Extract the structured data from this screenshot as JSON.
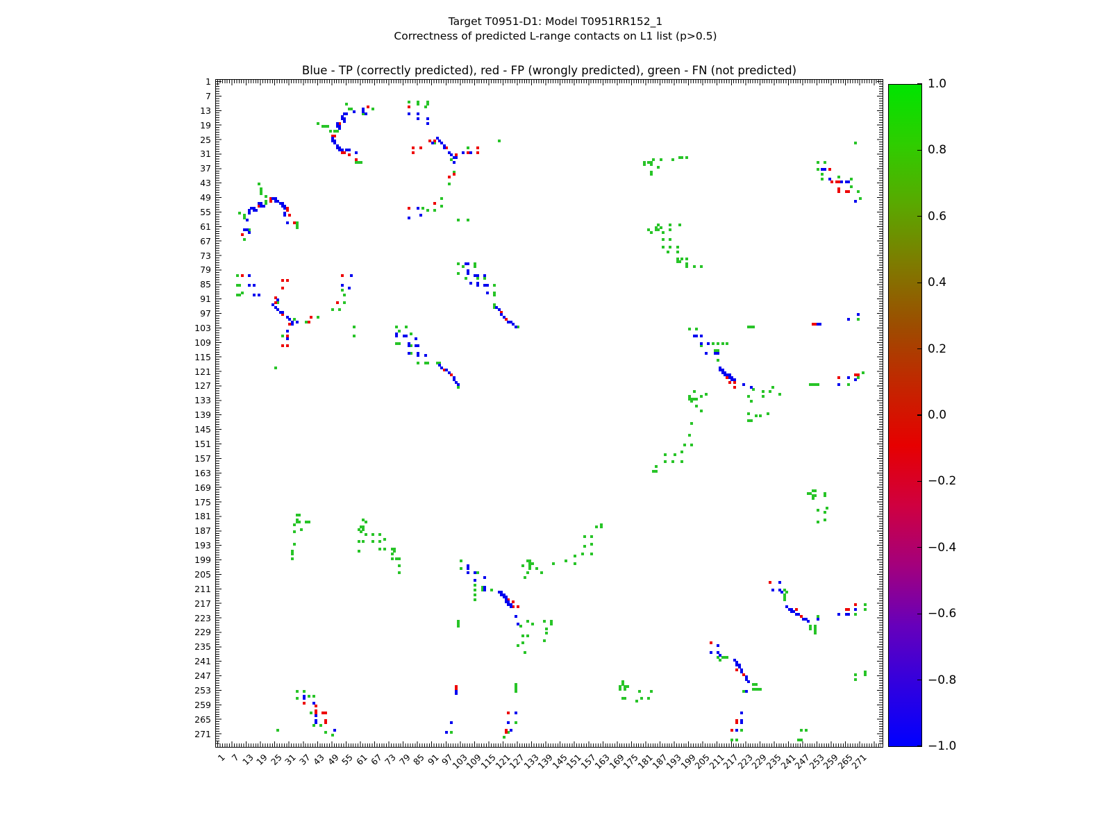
{
  "header": {
    "title_line1": "Target T0951-D1: Model T0951RR152_1",
    "title_line2": "Correctness of predicted L-range contacts on L1 list (p>0.5)"
  },
  "chart_data": {
    "type": "scatter",
    "title": "Blue - TP (correctly predicted), red - FP (wrongly predicted), green - FN (not predicted)",
    "xlabel": "",
    "ylabel": "",
    "axis": {
      "tick_first": 1,
      "tick_step": 6,
      "tick_last": 271,
      "xlim": [
        1,
        277
      ],
      "ylim": [
        277,
        1
      ],
      "y_inverted": true,
      "grid": false,
      "minor_ticks_every": 1
    },
    "legend": {
      "TP": {
        "label": "TP (correctly predicted)",
        "color": "#0000f0"
      },
      "FP": {
        "label": "FP (wrongly predicted)",
        "color": "#ee0000"
      },
      "FN": {
        "label": "FN (not predicted)",
        "color": "#28c428"
      }
    },
    "symmetric": true,
    "points_encoding": "pairs [residue_i, residue_j] on a symmetric contact map; each pair is also plotted mirrored [j,i]",
    "points": {
      "TP": [
        [
          49,
          24
        ],
        [
          49,
          25
        ],
        [
          50,
          25
        ],
        [
          50,
          26
        ],
        [
          51,
          27
        ],
        [
          51,
          28
        ],
        [
          52,
          28
        ],
        [
          52,
          29
        ],
        [
          53,
          29
        ],
        [
          51,
          18
        ],
        [
          51,
          19
        ],
        [
          52,
          19
        ],
        [
          52,
          20
        ],
        [
          53,
          15
        ],
        [
          53,
          16
        ],
        [
          54,
          16
        ],
        [
          54,
          17
        ],
        [
          54,
          14
        ],
        [
          55,
          14
        ],
        [
          55,
          29
        ],
        [
          56,
          29
        ],
        [
          58,
          13
        ],
        [
          59,
          30
        ],
        [
          62,
          12
        ],
        [
          62,
          13
        ],
        [
          63,
          14
        ],
        [
          81,
          14
        ],
        [
          85,
          14
        ],
        [
          85,
          16
        ],
        [
          89,
          16
        ],
        [
          89,
          18
        ],
        [
          91,
          26
        ],
        [
          81,
          57
        ],
        [
          85,
          53
        ],
        [
          86,
          56
        ],
        [
          93,
          24
        ],
        [
          94,
          25
        ],
        [
          95,
          26
        ],
        [
          96,
          27
        ],
        [
          96,
          28
        ],
        [
          98,
          30
        ],
        [
          99,
          31
        ],
        [
          100,
          32
        ],
        [
          101,
          32
        ],
        [
          100,
          34
        ],
        [
          104,
          30
        ],
        [
          107,
          30
        ],
        [
          105,
          76
        ],
        [
          106,
          76
        ],
        [
          106,
          79
        ],
        [
          106,
          80
        ],
        [
          107,
          84
        ],
        [
          109,
          81
        ],
        [
          110,
          81
        ],
        [
          110,
          84
        ],
        [
          110,
          85
        ],
        [
          113,
          81
        ],
        [
          113,
          85
        ],
        [
          114,
          85
        ],
        [
          114,
          88
        ],
        [
          118,
          94
        ],
        [
          119,
          95
        ],
        [
          120,
          97
        ],
        [
          121,
          98
        ],
        [
          123,
          100
        ],
        [
          124,
          100
        ],
        [
          125,
          101
        ],
        [
          126,
          102
        ],
        [
          201,
          106
        ],
        [
          202,
          106
        ],
        [
          204,
          106
        ],
        [
          204,
          109
        ],
        [
          206,
          113
        ],
        [
          207,
          109
        ],
        [
          210,
          113
        ],
        [
          211,
          113
        ],
        [
          212,
          119
        ],
        [
          212,
          120
        ],
        [
          213,
          120
        ],
        [
          213,
          121
        ],
        [
          214,
          121
        ],
        [
          214,
          122
        ],
        [
          215,
          122
        ],
        [
          216,
          122
        ],
        [
          216,
          123
        ],
        [
          217,
          123
        ],
        [
          217,
          124
        ],
        [
          218,
          124
        ],
        [
          222,
          126
        ],
        [
          225,
          127
        ],
        [
          253,
          101
        ],
        [
          254,
          101
        ],
        [
          262,
          126
        ],
        [
          266,
          123
        ],
        [
          269,
          124
        ],
        [
          266,
          99
        ],
        [
          270,
          97
        ],
        [
          255,
          37
        ],
        [
          256,
          37
        ],
        [
          258,
          41
        ],
        [
          263,
          42
        ],
        [
          265,
          42
        ],
        [
          266,
          42
        ],
        [
          269,
          50
        ],
        [
          234,
          211
        ],
        [
          237,
          208
        ],
        [
          237,
          211
        ],
        [
          238,
          212
        ],
        [
          240,
          218
        ],
        [
          241,
          219
        ],
        [
          242,
          219
        ],
        [
          242,
          220
        ],
        [
          243,
          220
        ],
        [
          244,
          221
        ],
        [
          245,
          221
        ],
        [
          247,
          223
        ],
        [
          248,
          223
        ],
        [
          249,
          224
        ],
        [
          253,
          223
        ],
        [
          262,
          221
        ],
        [
          265,
          221
        ],
        [
          266,
          221
        ],
        [
          269,
          219
        ]
      ],
      "FP": [
        [
          49,
          23
        ],
        [
          50,
          23
        ],
        [
          52,
          18
        ],
        [
          53,
          30
        ],
        [
          54,
          30
        ],
        [
          56,
          31
        ],
        [
          59,
          33
        ],
        [
          64,
          11
        ],
        [
          81,
          11
        ],
        [
          90,
          25
        ],
        [
          83,
          28
        ],
        [
          83,
          30
        ],
        [
          86,
          28
        ],
        [
          81,
          53
        ],
        [
          92,
          25
        ],
        [
          97,
          28
        ],
        [
          101,
          31
        ],
        [
          106,
          30
        ],
        [
          110,
          28
        ],
        [
          110,
          30
        ],
        [
          98,
          40
        ],
        [
          100,
          39
        ],
        [
          92,
          51
        ],
        [
          120,
          96
        ],
        [
          122,
          99
        ],
        [
          215,
          123
        ],
        [
          216,
          125
        ],
        [
          218,
          125
        ],
        [
          218,
          127
        ],
        [
          251,
          101
        ],
        [
          252,
          101
        ],
        [
          262,
          123
        ],
        [
          269,
          122
        ],
        [
          270,
          122
        ],
        [
          258,
          37
        ],
        [
          259,
          42
        ],
        [
          261,
          42
        ],
        [
          262,
          42
        ],
        [
          262,
          45
        ],
        [
          262,
          46
        ],
        [
          265,
          46
        ],
        [
          266,
          46
        ],
        [
          233,
          208
        ],
        [
          244,
          219
        ],
        [
          246,
          222
        ],
        [
          265,
          219
        ],
        [
          266,
          219
        ],
        [
          269,
          217
        ]
      ],
      "FN": [
        [
          43,
          18
        ],
        [
          45,
          19
        ],
        [
          46,
          19
        ],
        [
          47,
          19
        ],
        [
          48,
          21
        ],
        [
          50,
          21
        ],
        [
          51,
          21
        ],
        [
          55,
          10
        ],
        [
          56,
          12
        ],
        [
          57,
          12
        ],
        [
          59,
          34
        ],
        [
          60,
          34
        ],
        [
          61,
          34
        ],
        [
          62,
          14
        ],
        [
          66,
          12
        ],
        [
          81,
          9
        ],
        [
          85,
          9
        ],
        [
          85,
          10
        ],
        [
          89,
          9
        ],
        [
          89,
          10
        ],
        [
          88,
          11
        ],
        [
          87,
          53
        ],
        [
          89,
          54
        ],
        [
          92,
          26
        ],
        [
          99,
          33
        ],
        [
          98,
          43
        ],
        [
          100,
          38
        ],
        [
          106,
          28
        ],
        [
          119,
          25
        ],
        [
          95,
          49
        ],
        [
          95,
          52
        ],
        [
          92,
          54
        ],
        [
          102,
          58
        ],
        [
          106,
          58
        ],
        [
          102,
          76
        ],
        [
          102,
          80
        ],
        [
          104,
          77
        ],
        [
          105,
          82
        ],
        [
          109,
          76
        ],
        [
          109,
          77
        ],
        [
          110,
          82
        ],
        [
          113,
          82
        ],
        [
          117,
          85
        ],
        [
          117,
          88
        ],
        [
          117,
          89
        ],
        [
          117,
          93
        ],
        [
          117,
          94
        ],
        [
          127,
          102
        ],
        [
          184,
          162
        ],
        [
          180,
          34
        ],
        [
          180,
          35
        ],
        [
          182,
          34
        ],
        [
          183,
          34
        ],
        [
          183,
          35
        ],
        [
          183,
          38
        ],
        [
          183,
          39
        ],
        [
          184,
          33
        ],
        [
          187,
          33
        ],
        [
          186,
          36
        ],
        [
          192,
          33
        ],
        [
          195,
          32
        ],
        [
          196,
          32
        ],
        [
          198,
          32
        ],
        [
          182,
          62
        ],
        [
          183,
          63
        ],
        [
          185,
          61
        ],
        [
          185,
          62
        ],
        [
          186,
          60
        ],
        [
          186,
          62
        ],
        [
          187,
          61
        ],
        [
          188,
          63
        ],
        [
          188,
          66
        ],
        [
          188,
          69
        ],
        [
          191,
          60
        ],
        [
          191,
          62
        ],
        [
          191,
          66
        ],
        [
          191,
          69
        ],
        [
          190,
          71
        ],
        [
          195,
          60
        ],
        [
          194,
          69
        ],
        [
          194,
          71
        ],
        [
          194,
          74
        ],
        [
          194,
          75
        ],
        [
          195,
          75
        ],
        [
          196,
          74
        ],
        [
          198,
          74
        ],
        [
          198,
          76
        ],
        [
          198,
          77
        ],
        [
          201,
          77
        ],
        [
          204,
          77
        ],
        [
          199,
          103
        ],
        [
          202,
          103
        ],
        [
          204,
          110
        ],
        [
          209,
          109
        ],
        [
          211,
          109
        ],
        [
          213,
          109
        ],
        [
          215,
          109
        ],
        [
          210,
          112
        ],
        [
          211,
          112
        ],
        [
          211,
          116
        ],
        [
          199,
          131
        ],
        [
          199,
          132
        ],
        [
          200,
          132
        ],
        [
          200,
          133
        ],
        [
          201,
          129
        ],
        [
          201,
          132
        ],
        [
          202,
          132
        ],
        [
          204,
          131
        ],
        [
          206,
          130
        ],
        [
          202,
          135
        ],
        [
          204,
          137
        ],
        [
          224,
          131
        ],
        [
          225,
          133
        ],
        [
          226,
          128
        ],
        [
          230,
          129
        ],
        [
          230,
          131
        ],
        [
          233,
          129
        ],
        [
          234,
          127
        ],
        [
          237,
          130
        ],
        [
          224,
          138
        ],
        [
          224,
          141
        ],
        [
          225,
          141
        ],
        [
          227,
          139
        ],
        [
          229,
          139
        ],
        [
          232,
          138
        ],
        [
          185,
          160
        ],
        [
          185,
          162
        ],
        [
          189,
          155
        ],
        [
          189,
          158
        ],
        [
          193,
          155
        ],
        [
          192,
          158
        ],
        [
          196,
          154
        ],
        [
          196,
          158
        ],
        [
          197,
          151
        ],
        [
          199,
          147
        ],
        [
          200,
          151
        ],
        [
          200,
          142
        ],
        [
          224,
          102
        ],
        [
          225,
          102
        ],
        [
          226,
          102
        ],
        [
          250,
          126
        ],
        [
          251,
          126
        ],
        [
          252,
          126
        ],
        [
          253,
          126
        ],
        [
          266,
          126
        ],
        [
          270,
          123
        ],
        [
          272,
          121
        ],
        [
          270,
          99
        ],
        [
          249,
          171
        ],
        [
          250,
          171
        ],
        [
          251,
          170
        ],
        [
          251,
          172
        ],
        [
          252,
          170
        ],
        [
          252,
          172
        ],
        [
          251,
          173
        ],
        [
          256,
          171
        ],
        [
          256,
          172
        ],
        [
          253,
          178
        ],
        [
          253,
          183
        ],
        [
          257,
          177
        ],
        [
          256,
          179
        ],
        [
          256,
          182
        ],
        [
          253,
          34
        ],
        [
          253,
          37
        ],
        [
          256,
          34
        ],
        [
          255,
          39
        ],
        [
          255,
          41
        ],
        [
          262,
          40
        ],
        [
          267,
          41
        ],
        [
          267,
          44
        ],
        [
          269,
          26
        ],
        [
          270,
          46
        ],
        [
          271,
          49
        ],
        [
          239,
          211
        ],
        [
          240,
          212
        ],
        [
          239,
          213
        ],
        [
          239,
          214
        ],
        [
          239,
          215
        ],
        [
          250,
          226
        ],
        [
          250,
          227
        ],
        [
          252,
          226
        ],
        [
          252,
          227
        ],
        [
          252,
          228
        ],
        [
          252,
          229
        ],
        [
          253,
          222
        ],
        [
          269,
          221
        ],
        [
          269,
          246
        ],
        [
          269,
          248
        ],
        [
          273,
          217
        ],
        [
          273,
          219
        ],
        [
          273,
          245
        ],
        [
          273,
          246
        ]
      ]
    },
    "colorbar": {
      "tick_labels": [
        "1.0",
        "0.8",
        "0.6",
        "0.4",
        "0.2",
        "0.0",
        "−0.2",
        "−0.4",
        "−0.6",
        "−0.8",
        "−1.0"
      ],
      "gradient_stops": [
        "#00e400",
        "#2fcd00",
        "#5aa800",
        "#7f7a00",
        "#9c4d00",
        "#c32600",
        "#e60000",
        "#cf0040",
        "#a3007d",
        "#6600bb",
        "#3000e0",
        "#0000ff"
      ],
      "vmin": -1.0,
      "vmax": 1.0
    }
  }
}
